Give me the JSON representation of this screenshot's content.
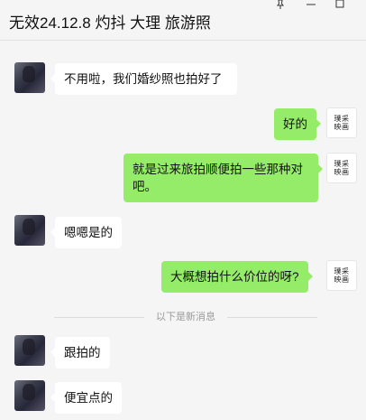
{
  "header": {
    "title": "无效24.12.8 灼抖 大理 旅游照",
    "controls": {
      "pin": "pin-icon",
      "minimize": "minimize-icon",
      "maximize": "maximize-icon"
    }
  },
  "me_avatar_text": {
    "line1": "璞采",
    "line2": "映画"
  },
  "messages": [
    {
      "side": "in",
      "text": "不用啦，我们婚纱照也拍好了"
    },
    {
      "side": "out",
      "text": "好的"
    },
    {
      "side": "out",
      "text": "就是过来旅拍顺便拍一些那种对吧。"
    },
    {
      "side": "in",
      "text": "嗯嗯是的"
    },
    {
      "side": "out",
      "text": "大概想拍什么价位的呀?"
    },
    {
      "side": "in",
      "text": "跟拍的"
    },
    {
      "side": "in",
      "text": "便宜点的"
    }
  ],
  "new_messages_divider": "以下是新消息",
  "colors": {
    "background": "#f5f5f5",
    "incoming_bubble": "#ffffff",
    "outgoing_bubble": "#95ec69"
  }
}
